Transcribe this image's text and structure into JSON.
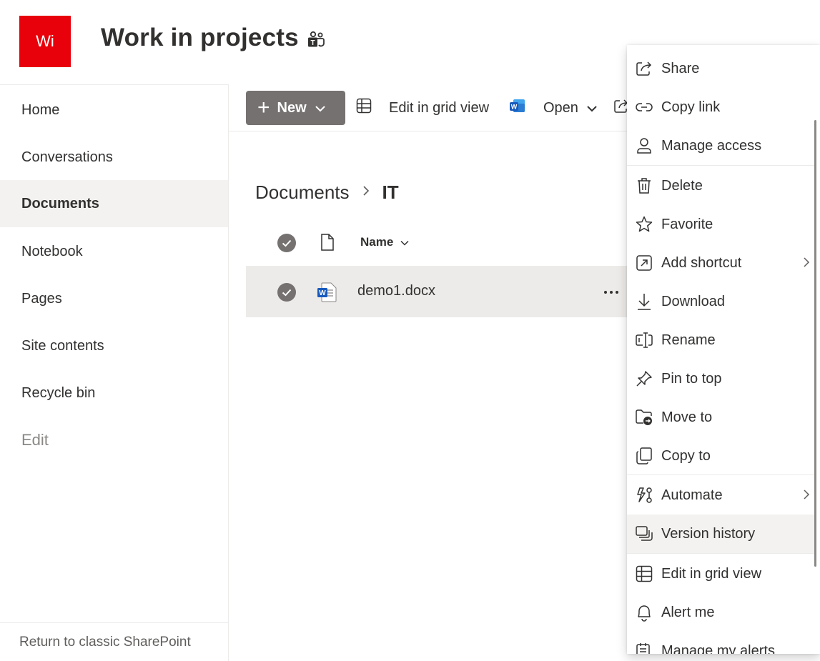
{
  "site": {
    "logo_text": "Wi",
    "logo_color": "#e8000b",
    "title": "Work in projects"
  },
  "nav": {
    "items": [
      {
        "label": "Home"
      },
      {
        "label": "Conversations"
      },
      {
        "label": "Documents",
        "selected": true
      },
      {
        "label": "Notebook"
      },
      {
        "label": "Pages"
      },
      {
        "label": "Site contents"
      },
      {
        "label": "Recycle bin"
      },
      {
        "label": "Edit"
      }
    ],
    "footer": "Return to classic SharePoint"
  },
  "commandbar": {
    "new_label": "New",
    "grid_label": "Edit in grid view",
    "open_label": "Open"
  },
  "breadcrumb": {
    "parent": "Documents",
    "current": "IT"
  },
  "list": {
    "name_header": "Name",
    "rows": [
      {
        "name": "demo1.docx",
        "selected": true
      }
    ]
  },
  "context_menu": {
    "items": [
      {
        "label": "Share",
        "icon": "share-icon"
      },
      {
        "label": "Copy link",
        "icon": "link-icon"
      },
      {
        "label": "Manage access",
        "icon": "person-icon"
      },
      {
        "label": "Delete",
        "icon": "trash-icon"
      },
      {
        "label": "Favorite",
        "icon": "star-icon"
      },
      {
        "label": "Add shortcut",
        "icon": "shortcut-icon"
      },
      {
        "label": "Download",
        "icon": "download-icon"
      },
      {
        "label": "Rename",
        "icon": "rename-icon"
      },
      {
        "label": "Pin to top",
        "icon": "pin-icon"
      },
      {
        "label": "Move to",
        "icon": "move-icon"
      },
      {
        "label": "Copy to",
        "icon": "copy-icon"
      },
      {
        "label": "Automate",
        "icon": "automate-icon"
      },
      {
        "label": "Version history",
        "icon": "history-icon",
        "hover": true
      },
      {
        "label": "Edit in grid view",
        "icon": "grid-icon"
      },
      {
        "label": "Alert me",
        "icon": "bell-icon"
      },
      {
        "label": "Manage my alerts",
        "icon": "alerts-icon"
      }
    ]
  },
  "colors": {
    "accent_button": "#767171",
    "selected_bg": "#edebe9",
    "word_blue": "#185abd"
  }
}
